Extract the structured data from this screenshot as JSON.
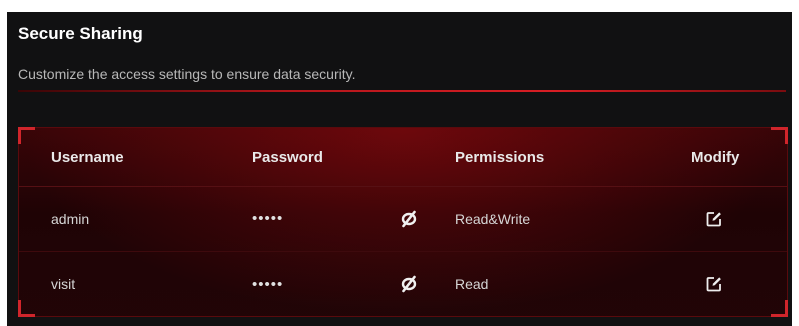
{
  "header": {
    "title": "Secure Sharing",
    "description": "Customize the access settings to ensure data security."
  },
  "table": {
    "columns": [
      "Username",
      "Password",
      "Permissions",
      "Modify"
    ],
    "rows": [
      {
        "username": "admin",
        "password": "•••••",
        "permissions": "Read&Write"
      },
      {
        "username": "visit",
        "password": "•••••",
        "permissions": "Read"
      }
    ]
  },
  "icons": {
    "toggle_visibility": "eye-slash-icon",
    "modify": "edit-icon"
  },
  "colors": {
    "accent": "#d81e24",
    "panel_bg": "#111112",
    "table_bg": "#2a0407"
  }
}
